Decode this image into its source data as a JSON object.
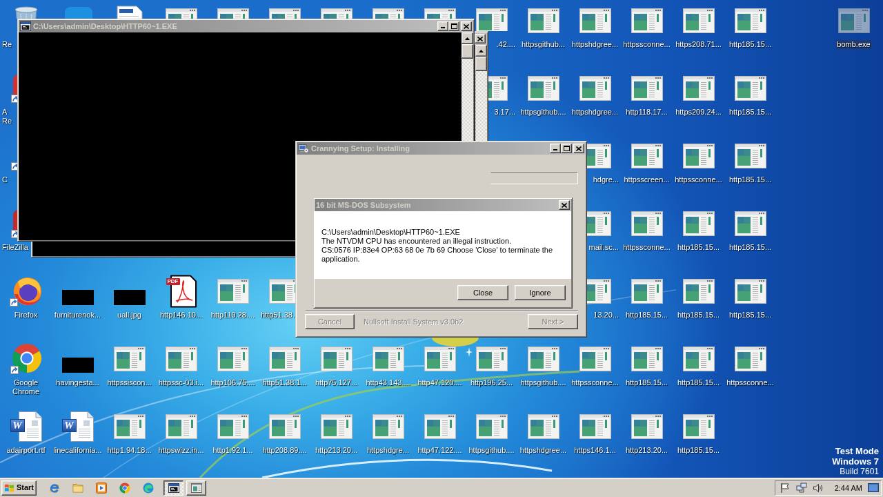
{
  "desktop": {
    "icon_rows": [
      [
        {
          "kind": "bin",
          "label": "Re",
          "covered_right": true,
          "selected": false
        },
        {
          "kind": "app",
          "color": "#1e90e0",
          "selected": false
        },
        {
          "kind": "document",
          "selected": false
        },
        {
          "kind": "web",
          "selected": false
        },
        {
          "kind": "web",
          "selected": false
        },
        {
          "kind": "web",
          "selected": false
        },
        {
          "kind": "web",
          "selected": false
        },
        {
          "kind": "web",
          "selected": false
        },
        {
          "kind": "web",
          "selected": false
        },
        {
          "kind": "web",
          "label": ".42....",
          "covered_left": true,
          "selected": false
        },
        {
          "kind": "web",
          "label": "httpsgithub...",
          "selected": false
        },
        {
          "kind": "web",
          "label": "httpshdgree...",
          "selected": false
        },
        {
          "kind": "web",
          "label": "httpssconne...",
          "selected": false
        },
        {
          "kind": "web",
          "label": "https208.71...",
          "selected": false
        },
        {
          "kind": "web",
          "label": "http185.15...",
          "selected": false
        },
        null,
        {
          "kind": "web",
          "label": "bomb.exe",
          "selected": true
        }
      ],
      [
        {
          "kind": "app",
          "color": "#d32f2f",
          "label": "A\nRe",
          "covered_right": true,
          "selected": false
        },
        null,
        null,
        null,
        null,
        null,
        null,
        null,
        null,
        {
          "kind": "web",
          "label": "3.17...",
          "covered_left": true,
          "selected": false
        },
        {
          "kind": "web",
          "label": "httpsgithub....",
          "selected": false
        },
        {
          "kind": "web",
          "label": "httpshdgree...",
          "selected": false
        },
        {
          "kind": "web",
          "label": "http118.17...",
          "selected": false
        },
        {
          "kind": "web",
          "label": "https209.24...",
          "selected": false
        },
        {
          "kind": "web",
          "label": "http185.15...",
          "selected": false
        }
      ],
      [
        {
          "kind": "app",
          "label": "C",
          "covered_right": true,
          "selected": false
        },
        null,
        null,
        null,
        null,
        null,
        null,
        null,
        null,
        null,
        null,
        {
          "kind": "web",
          "label": "hdgre...",
          "covered_left": true,
          "selected": false
        },
        {
          "kind": "web",
          "label": "httpsscreen...",
          "selected": false
        },
        {
          "kind": "web",
          "label": "httpssconne...",
          "selected": false
        },
        {
          "kind": "web",
          "label": "http185.15...",
          "selected": false
        }
      ],
      [
        {
          "kind": "app",
          "color": "#c62828",
          "label": "FileZilla",
          "covered_right": true,
          "selected": false
        },
        null,
        null,
        null,
        null,
        null,
        null,
        null,
        null,
        null,
        null,
        {
          "kind": "web",
          "label": "mail.sc...",
          "covered_left": true,
          "selected": false
        },
        {
          "kind": "web",
          "label": "httpssconne...",
          "selected": false
        },
        {
          "kind": "web",
          "label": "http185.15...",
          "selected": false
        },
        {
          "kind": "web",
          "label": "http185.15...",
          "selected": false
        }
      ],
      [
        {
          "kind": "firefox",
          "label": "Firefox",
          "selected": false
        },
        {
          "kind": "image",
          "label": "furniturenok...",
          "selected": false
        },
        {
          "kind": "image",
          "label": "uall.jpg",
          "selected": false
        },
        {
          "kind": "pdf",
          "badge": "PDF",
          "label": "http146.10...",
          "selected": false
        },
        {
          "kind": "web",
          "label": "http119.28....",
          "selected": false
        },
        {
          "kind": "web",
          "label": "http51.38.",
          "covered_right": true,
          "selected": false
        },
        null,
        null,
        null,
        null,
        null,
        {
          "kind": "web",
          "label": "13.20...",
          "covered_left": true,
          "selected": false
        },
        {
          "kind": "web",
          "label": "http185.15...",
          "selected": false
        },
        {
          "kind": "web",
          "label": "http185.15...",
          "selected": false
        },
        {
          "kind": "web",
          "label": "http185.15...",
          "selected": false
        }
      ],
      [
        {
          "kind": "chrome",
          "label": "Google Chrome",
          "selected": false
        },
        {
          "kind": "image",
          "label": "havingesta...",
          "selected": false
        },
        {
          "kind": "web",
          "label": "httpssiscon...",
          "selected": false
        },
        {
          "kind": "web",
          "label": "httpssc-03.i...",
          "selected": false
        },
        {
          "kind": "web",
          "label": "http106.75....",
          "selected": false
        },
        {
          "kind": "web",
          "label": "http51.38.1...",
          "selected": false
        },
        {
          "kind": "web",
          "label": "http75.127...",
          "selected": false
        },
        {
          "kind": "web",
          "label": "http43.143....",
          "selected": false
        },
        {
          "kind": "web",
          "label": "http47.120....",
          "selected": false
        },
        {
          "kind": "web",
          "label": "http196.25...",
          "selected": false
        },
        {
          "kind": "web",
          "label": "httpsgithub....",
          "selected": false
        },
        {
          "kind": "web",
          "label": "httpssconne...",
          "selected": false
        },
        {
          "kind": "web",
          "label": "http185.15...",
          "selected": false
        },
        {
          "kind": "web",
          "label": "http185.15...",
          "selected": false
        },
        {
          "kind": "web",
          "label": "httpssconne...",
          "selected": false
        }
      ],
      [
        {
          "kind": "word",
          "badge": "W",
          "label": "adairport.rtf",
          "selected": false
        },
        {
          "kind": "word",
          "badge": "W",
          "label": "linecalifornia...",
          "selected": false
        },
        {
          "kind": "web",
          "label": "http1.94.18...",
          "selected": false
        },
        {
          "kind": "web",
          "label": "httpswizz.in...",
          "selected": false
        },
        {
          "kind": "web",
          "label": "http1.92.1...",
          "selected": false
        },
        {
          "kind": "web",
          "label": "http208.89....",
          "selected": false
        },
        {
          "kind": "web",
          "label": "http213.20...",
          "selected": false
        },
        {
          "kind": "web",
          "label": "httpshdgre...",
          "selected": false
        },
        {
          "kind": "web",
          "label": "http47.122....",
          "selected": false
        },
        {
          "kind": "web",
          "label": "httpsgithub....",
          "selected": false
        },
        {
          "kind": "web",
          "label": "httpshdgree...",
          "selected": false
        },
        {
          "kind": "web",
          "label": "https146.1...",
          "selected": false
        },
        {
          "kind": "web",
          "label": "http213.20...",
          "selected": false
        },
        {
          "kind": "web",
          "label": "http185.15...",
          "selected": false
        }
      ]
    ],
    "notice": [
      "Test Mode",
      "Windows 7",
      "Build 7601"
    ]
  },
  "windows": [
    {
      "kind": "console",
      "controls": [
        {
          "kind": "close"
        }
      ]
    },
    {
      "kind": "console",
      "title": "C:\\Users\\admin\\Desktop\\HTTP60~1.EXE",
      "controls": [
        {
          "kind": "minimize"
        },
        {
          "kind": "maximize"
        },
        {
          "kind": "close"
        }
      ]
    },
    {
      "kind": "installer",
      "title": "Crannying Setup: Installing",
      "controls": [
        {
          "kind": "minimize"
        },
        {
          "kind": "maximize"
        },
        {
          "kind": "close"
        }
      ],
      "buttons": [
        {
          "label": "Cancel",
          "disabled": true
        },
        {
          "label": "Next >",
          "disabled": true
        }
      ],
      "branding": "Nullsoft Install System v3.0b2"
    },
    {
      "kind": "message",
      "title": "16 bit MS-DOS Subsystem",
      "controls": [
        {
          "kind": "close"
        }
      ],
      "message": "C:\\Users\\admin\\Desktop\\HTTP60~1.EXE\nThe NTVDM CPU has encountered an illegal instruction.\nCS:0576 IP:83e4 OP:63 68 0e 7b 69 Choose 'Close' to terminate the application.",
      "buttons": [
        {
          "label": "Close",
          "disabled": false
        },
        {
          "label": "Ignore",
          "disabled": false
        }
      ]
    }
  ],
  "taskbar": {
    "start_label": "Start",
    "quick_launch": [
      {
        "kind": "ie"
      },
      {
        "kind": "folder"
      },
      {
        "kind": "media_player"
      },
      {
        "kind": "chrome"
      },
      {
        "kind": "edge"
      }
    ],
    "tasks": [
      {
        "kind": "console",
        "selected": true
      },
      {
        "kind": "window",
        "selected": false
      }
    ],
    "tray_icons": [
      {
        "kind": "flag"
      },
      {
        "kind": "network"
      },
      {
        "kind": "volume"
      }
    ],
    "clock": "2:44 AM"
  }
}
